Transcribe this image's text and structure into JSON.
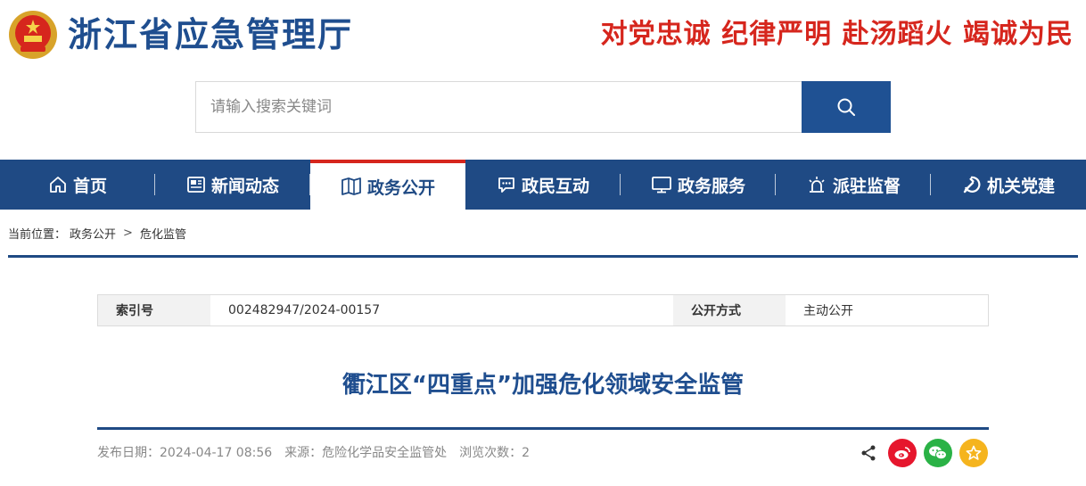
{
  "header": {
    "site_title": "浙江省应急管理厅",
    "slogan": "对党忠诚 纪律严明 赴汤蹈火 竭诚为民",
    "emblem_icon": "national-emblem-icon"
  },
  "search": {
    "placeholder": "请输入搜索关键词",
    "value": "",
    "button_icon": "search-icon"
  },
  "nav": {
    "items": [
      {
        "label": "首页",
        "icon": "home-icon",
        "active": false
      },
      {
        "label": "新闻动态",
        "icon": "newspaper-icon",
        "active": false
      },
      {
        "label": "政务公开",
        "icon": "open-book-icon",
        "active": true
      },
      {
        "label": "政民互动",
        "icon": "chat-icon",
        "active": false
      },
      {
        "label": "政务服务",
        "icon": "monitor-icon",
        "active": false
      },
      {
        "label": "派驻监督",
        "icon": "alarm-light-icon",
        "active": false
      },
      {
        "label": "机关党建",
        "icon": "party-emblem-icon",
        "active": false
      }
    ]
  },
  "breadcrumb": {
    "prefix": "当前位置：",
    "level1": "政务公开",
    "separator": ">",
    "level2": "危化监管"
  },
  "info": {
    "index_label": "索引号",
    "index_value": "002482947/2024-00157",
    "open_label": "公开方式",
    "open_value": "主动公开"
  },
  "article": {
    "title": "衢江区“四重点”加强危化领域安全监管",
    "date_label": "发布日期：",
    "date_value": "2024-04-17 08:56",
    "source_label": "来源：",
    "source_value": "危险化学品安全监管处",
    "views_label": "浏览次数：",
    "views_value": "2"
  },
  "share": {
    "icons": [
      "share-icon",
      "weibo-icon",
      "wechat-icon",
      "favorite-star-icon"
    ]
  },
  "colors": {
    "brand_blue": "#1f4a84",
    "title_blue": "#1f4e8f",
    "slogan_red": "#d6261d",
    "weibo_red": "#e6162d",
    "wechat_green": "#2ab246",
    "star_yellow": "#f5b41e"
  }
}
